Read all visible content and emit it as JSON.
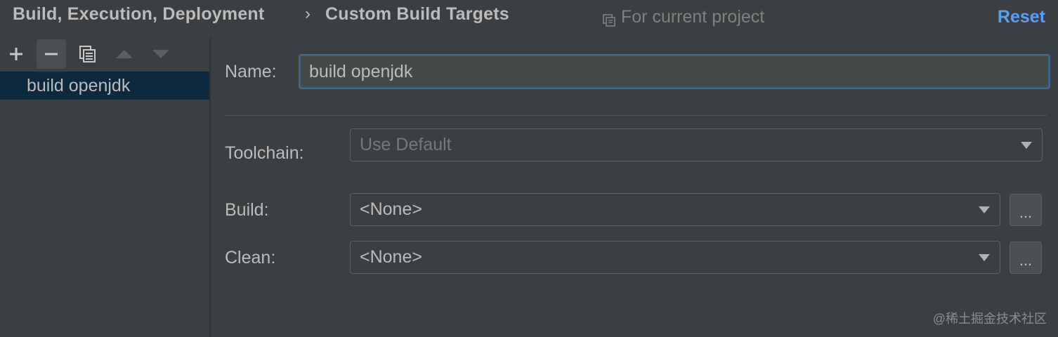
{
  "header": {
    "breadcrumb": [
      "Build, Execution, Deployment",
      "Custom Build Targets"
    ],
    "separator": "›",
    "scope_label": "For current project",
    "reset_label": "Reset"
  },
  "toolbar": {
    "icons": [
      "add-icon",
      "remove-icon",
      "copy-icon",
      "move-up-icon",
      "move-down-icon"
    ]
  },
  "targets": [
    {
      "label": "build openjdk",
      "selected": true
    }
  ],
  "form": {
    "name_label": "Name:",
    "name_value": "build openjdk",
    "toolchain_label": "Toolchain:",
    "toolchain_value": "Use Default",
    "build_label": "Build:",
    "build_value": "<None>",
    "clean_label": "Clean:",
    "clean_value": "<None>",
    "ellipsis_label": "..."
  },
  "watermark": "@稀土掘金技术社区",
  "colors": {
    "background": "#3c3f41",
    "selection": "#0d293e",
    "accent": "#589df6",
    "focus_border": "#3d6185"
  }
}
